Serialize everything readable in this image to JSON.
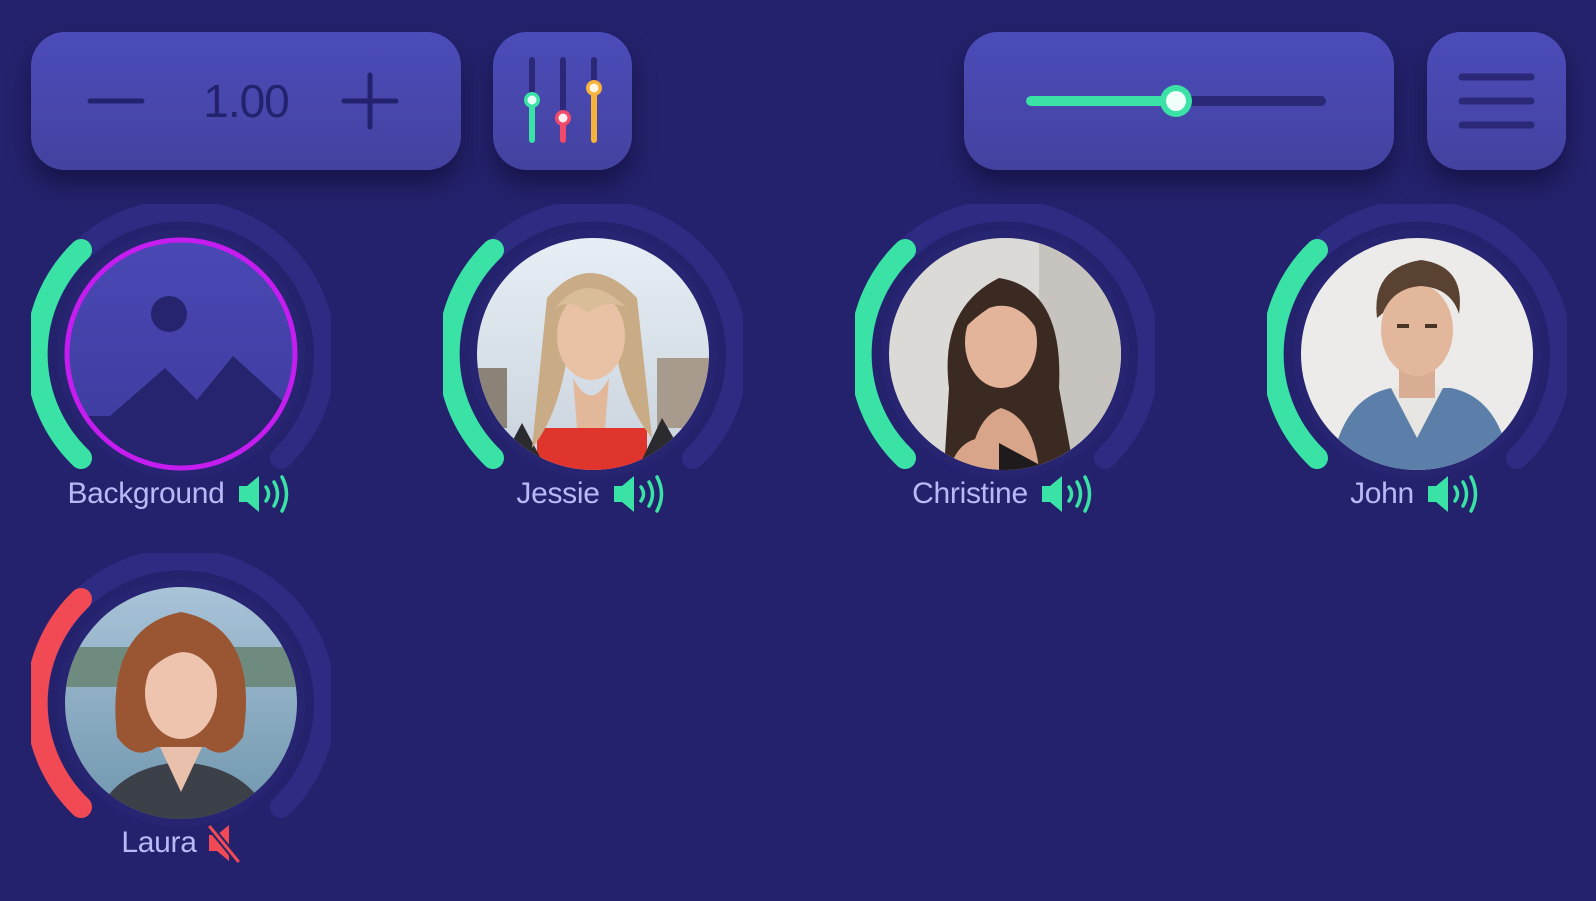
{
  "toolbar": {
    "speed_value": "1.00",
    "volume_level": 0.5
  },
  "colors": {
    "background": "#24226c",
    "panel": "#4848b0",
    "active_green": "#3ae3a5",
    "muted_red": "#f24a54",
    "background_highlight": "#c51cf0"
  },
  "participants": [
    {
      "name": "Background",
      "audio": "on",
      "avatar": "image-placeholder-icon"
    },
    {
      "name": "Jessie",
      "audio": "on",
      "avatar": "photo"
    },
    {
      "name": "Christine",
      "audio": "on",
      "avatar": "photo"
    },
    {
      "name": "John",
      "audio": "on",
      "avatar": "photo"
    },
    {
      "name": "Laura",
      "audio": "muted",
      "avatar": "photo"
    }
  ]
}
